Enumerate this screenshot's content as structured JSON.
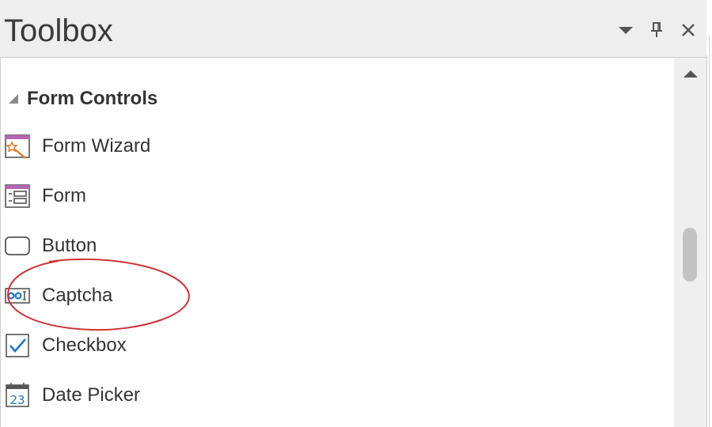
{
  "window": {
    "title": "Toolbox",
    "dropdown_icon": "triangle-down-icon",
    "pin_icon": "pin-icon",
    "close_icon": "close-icon"
  },
  "toolbox": {
    "group": {
      "label": "Form Controls",
      "expanded": true
    },
    "items": [
      {
        "label": "Form Wizard",
        "icon": "form-wizard-icon"
      },
      {
        "label": "Form",
        "icon": "form-icon"
      },
      {
        "label": "Button",
        "icon": "button-icon"
      },
      {
        "label": "Captcha",
        "icon": "captcha-icon"
      },
      {
        "label": "Checkbox",
        "icon": "checkbox-icon"
      },
      {
        "label": "Date Picker",
        "icon": "date-picker-icon"
      }
    ],
    "date_picker_icon_text": "23"
  },
  "colors": {
    "accent_purple": "#b565b5",
    "accent_blue": "#1e78c8",
    "annotation_red": "#cc3333",
    "icon_gray": "#505050"
  }
}
